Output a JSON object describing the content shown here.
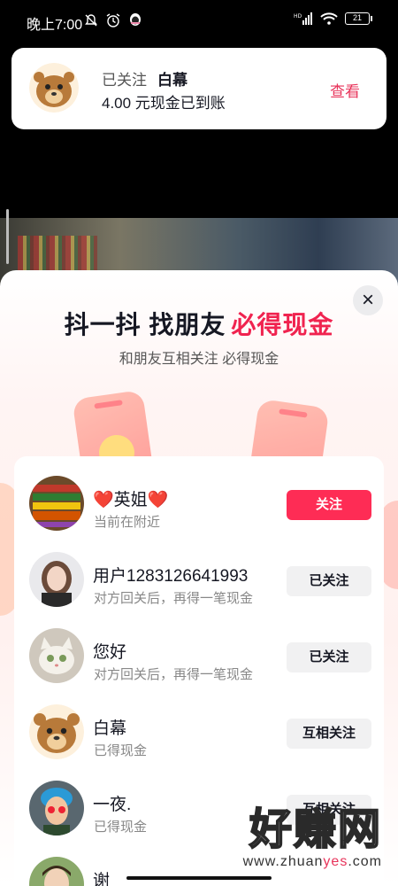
{
  "status_bar": {
    "time": "晚上7:00",
    "icons": [
      "bell-off-icon",
      "alarm-icon",
      "qq-icon"
    ],
    "right_icons": [
      "signal-icon",
      "wifi-icon"
    ],
    "battery": "21"
  },
  "notification": {
    "line1_prefix": "已关注",
    "name": "白幕",
    "line2": "4.00 元现金已到账",
    "action": "查看"
  },
  "sheet": {
    "close_icon": "×",
    "title_main": "抖一抖 找朋友",
    "title_highlight": "必得现金",
    "subtitle": "和朋友互相关注 必得现金"
  },
  "friends": [
    {
      "name_heart_left": "❤️",
      "name": "英姐",
      "name_heart_right": "❤️",
      "subtitle": "当前在附近",
      "button": "关注",
      "primary": true
    },
    {
      "name": "用户1283126641993",
      "subtitle": "对方回关后，再得一笔现金",
      "button": "已关注",
      "primary": false
    },
    {
      "name": "您好",
      "subtitle": "对方回关后，再得一笔现金",
      "button": "已关注",
      "primary": false
    },
    {
      "name": "白幕",
      "subtitle": "已得现金",
      "button": "互相关注",
      "primary": false
    },
    {
      "name": "一夜.",
      "subtitle": "已得现金",
      "button": "互相关注",
      "primary": false
    },
    {
      "name": "谢",
      "subtitle": "",
      "button": "",
      "primary": false
    }
  ],
  "watermark": {
    "big": "好赚网",
    "small_a": "www.zhuan",
    "small_b": "yes",
    "small_c": ".com"
  },
  "colors": {
    "accent": "#fe2c55",
    "highlight": "#f0234f"
  }
}
